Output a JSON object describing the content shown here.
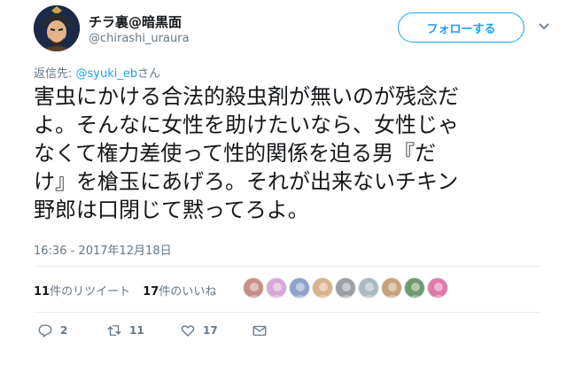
{
  "user": {
    "display_name": "チラ裏@暗黒面",
    "handle": "@chirashi_uraura",
    "avatar_icon": "samurai-avatar-icon"
  },
  "follow_button": {
    "label": "フォローする"
  },
  "menu": {
    "icon": "chevron-down-icon"
  },
  "reply": {
    "prefix": "返信先: ",
    "mention": "@syuki_eb",
    "suffix": "さん"
  },
  "tweet": {
    "text": "害虫にかける合法的殺虫剤が無いのが残念だ\nよ。そんなに女性を助けたいなら、女性じゃ\nなくて権力差使って性的関係を迫る男『だ\nけ』を槍玉にあげろ。それが出来ないチキン\n野郎は口閉じて黙ってろよ。",
    "timestamp": "16:36 - 2017年12月18日"
  },
  "stats": {
    "retweets_count": "11",
    "retweets_label": "件のリツイート",
    "likes_count": "17",
    "likes_label": "件のいいね"
  },
  "likers": [
    {
      "color": "#c98f86",
      "icon": "liker-avatar-icon"
    },
    {
      "color": "#d7a9d6",
      "icon": "liker-avatar-icon"
    },
    {
      "color": "#8fa3c7",
      "icon": "liker-avatar-icon"
    },
    {
      "color": "#d9b38c",
      "icon": "liker-avatar-icon"
    },
    {
      "color": "#9aa0a6",
      "icon": "liker-avatar-icon"
    },
    {
      "color": "#aab8c2",
      "icon": "liker-avatar-icon"
    },
    {
      "color": "#c8a27a",
      "icon": "liker-avatar-icon"
    },
    {
      "color": "#6f9a6f",
      "icon": "liker-avatar-icon"
    },
    {
      "color": "#e07aa8",
      "icon": "liker-avatar-icon"
    }
  ],
  "actions": {
    "reply_count": "2",
    "retweet_count": "11",
    "like_count": "17"
  },
  "colors": {
    "accent": "#1da1f2",
    "secondary_text": "#657786",
    "primary_text": "#14171a"
  }
}
